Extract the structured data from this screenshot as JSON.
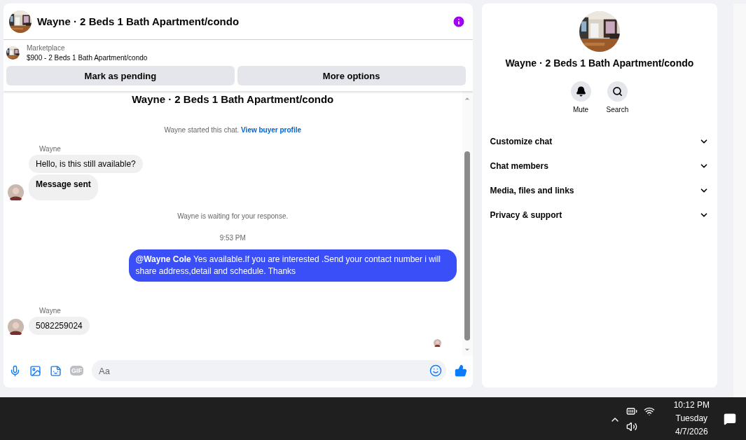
{
  "chat_header": {
    "title": "Wayne · 2 Beds 1 Bath Apartment/condo"
  },
  "listing": {
    "source": "Marketplace",
    "title": "$900 - 2 Beds 1 Bath Apartment/condo",
    "buttons": [
      "Mark as pending",
      "More options"
    ]
  },
  "conversation": {
    "heading": "Wayne · 2 Beds 1 Bath Apartment/condo",
    "messages": [
      {
        "kind": "notice",
        "text": "Wayne started this chat.",
        "link": "View buyer profile"
      },
      {
        "kind": "incoming",
        "sender": "Wayne",
        "bubbles": [
          {
            "text": "Hello, is this still available?",
            "bold": false
          },
          {
            "text": "Message sent",
            "bold": true
          }
        ]
      },
      {
        "kind": "notice",
        "text": "Wayne is waiting for your response."
      },
      {
        "kind": "timestamp",
        "text": "9:53 PM"
      },
      {
        "kind": "outgoing",
        "text": "**@Wayne Cole**  Yes available.If you are interested .Send your contact number i will share address,detail and schedule. Thanks"
      },
      {
        "kind": "incoming",
        "sender": "Wayne",
        "bubbles": [
          {
            "text": "5082259024",
            "bold": false
          }
        ]
      }
    ]
  },
  "composer": {
    "gif_label": "GIF",
    "placeholder": "Aa"
  },
  "details_panel": {
    "title": "Wayne · 2 Beds 1 Bath Apartment/condo",
    "actions": [
      {
        "kind": "mute",
        "label": "Mute"
      },
      {
        "kind": "search",
        "label": "Search"
      }
    ],
    "sections": [
      {
        "label": "Customize chat",
        "expanded": false
      },
      {
        "label": "Chat members",
        "expanded": false
      },
      {
        "label": "Media, files and links",
        "expanded": false
      },
      {
        "label": "Privacy & support",
        "expanded": false
      }
    ]
  },
  "taskbar": {
    "time": "10:12 PM",
    "day": "Tuesday",
    "date": "4/7/2026"
  }
}
